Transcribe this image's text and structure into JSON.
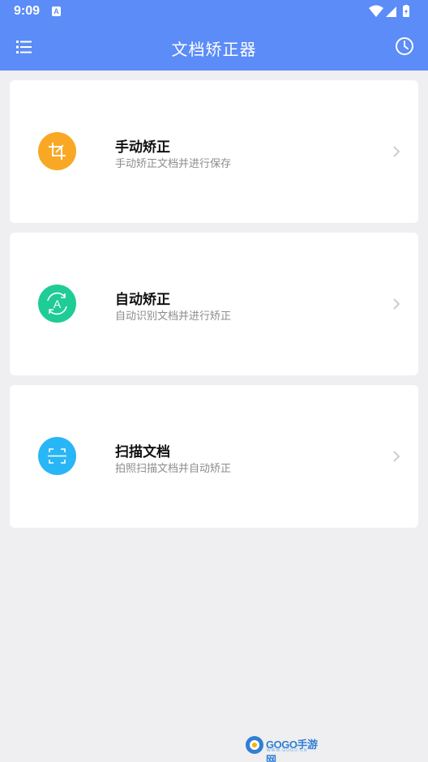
{
  "status_bar": {
    "time": "9:09",
    "notification_icon": "a-icon"
  },
  "app_bar": {
    "title": "文档矫正器",
    "menu_icon": "list-icon",
    "history_icon": "clock-icon",
    "color": "#5b8cf7"
  },
  "cards": [
    {
      "title": "手动矫正",
      "subtitle": "手动矫正文档并进行保存",
      "icon": "crop-icon",
      "icon_color": "#f9a825"
    },
    {
      "title": "自动矫正",
      "subtitle": "自动识别文档并进行矫正",
      "icon": "auto-a-icon",
      "icon_color": "#1fcc95"
    },
    {
      "title": "扫描文档",
      "subtitle": "拍照扫描文档并自动矫正",
      "icon": "scan-icon",
      "icon_color": "#29b6f6"
    }
  ],
  "watermark": {
    "text": "GOGO手游网",
    "sub": "WWW.GOGO.CN"
  }
}
